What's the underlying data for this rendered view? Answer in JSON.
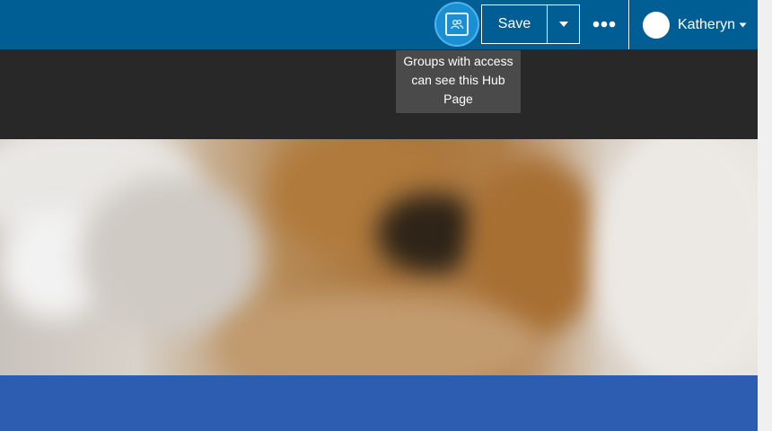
{
  "header": {
    "share_icon": "groups-icon",
    "save_label": "Save",
    "save_dropdown_icon": "chevron-down-icon",
    "more_icon": "ellipsis-icon",
    "user": {
      "name": "Katheryn",
      "avatar_icon": "avatar-icon",
      "caret_icon": "chevron-down-icon"
    }
  },
  "tooltip": {
    "line1": "Groups with access",
    "line2": "can see this Hub",
    "line3": "Page"
  },
  "colors": {
    "header_bg": "#005e95",
    "dark_band": "#282828",
    "blue_band": "#2c5db0"
  }
}
